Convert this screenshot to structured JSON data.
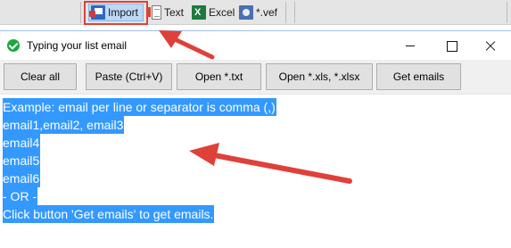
{
  "toolbar": {
    "import_label": "Import",
    "text_label": "Text",
    "excel_label": "Excel",
    "vcf_label": "*.vef"
  },
  "window": {
    "title": "Typing your list email"
  },
  "buttons": {
    "clear_all": "Clear all",
    "paste": "Paste (Ctrl+V)",
    "open_txt": "Open *.txt",
    "open_xls": "Open *.xls, *.xlsx",
    "get_emails": "Get emails"
  },
  "editor": {
    "lines": [
      "Example: email per line or separator is comma (,)",
      "email1,email2, email3",
      "email4",
      "email5",
      "email6",
      "- OR -",
      "Click button 'Get emails' to get emails."
    ]
  },
  "colors": {
    "selection": "#3399ff",
    "annotation_arrow": "#e0403a",
    "title_icon": "#1ea83c"
  },
  "icons": {
    "import": "import-icon",
    "text": "text-file-icon",
    "excel": "excel-icon",
    "vcf": "vcf-icon",
    "title": "check-circle-icon"
  }
}
